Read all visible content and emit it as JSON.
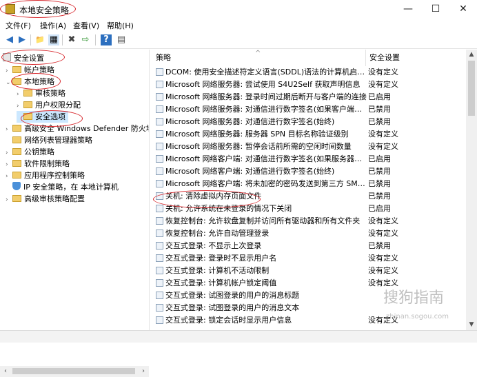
{
  "window": {
    "title": "本地安全策略",
    "minimize": "—",
    "maximize": "☐",
    "close": "✕"
  },
  "menu": [
    "文件(F)",
    "操作(A)",
    "查看(V)",
    "帮助(H)"
  ],
  "toolbar": {
    "back": "◀",
    "forward": "▶",
    "up": "📁",
    "show_hide": "▦",
    "delete": "✖",
    "export": "⇨",
    "help": "?",
    "properties": "▤"
  },
  "tree": {
    "root": "安全设置",
    "account": "帐户策略",
    "local": "本地策略",
    "audit": "审核策略",
    "rights": "用户权限分配",
    "security_options": "安全选项",
    "defender": "高级安全 Windows Defender 防火墙",
    "netlist": "网络列表管理器策略",
    "pubkey": "公钥策略",
    "swr": "软件限制策略",
    "applocker": "应用程序控制策略",
    "ipsec": "IP 安全策略，在 本地计算机",
    "advaudit": "高级审核策略配置"
  },
  "columns": {
    "policy": "策略",
    "setting": "安全设置"
  },
  "policies": [
    {
      "name": "DCOM: 使用安全描述符定义语言(SDDL)语法的计算机启动...",
      "value": "没有定义"
    },
    {
      "name": "Microsoft 网络服务器: 尝试使用 S4U2Self 获取声明信息",
      "value": "没有定义"
    },
    {
      "name": "Microsoft 网络服务器: 登录时间过期后断开与客户端的连接",
      "value": "已启用"
    },
    {
      "name": "Microsoft 网络服务器: 对通信进行数字签名(如果客户端允...",
      "value": "已禁用"
    },
    {
      "name": "Microsoft 网络服务器: 对通信进行数字签名(始终)",
      "value": "已禁用"
    },
    {
      "name": "Microsoft 网络服务器: 服务器 SPN 目标名称验证级别",
      "value": "没有定义"
    },
    {
      "name": "Microsoft 网络服务器: 暂停会话前所需的空闲时间数量",
      "value": "没有定义"
    },
    {
      "name": "Microsoft 网络客户端: 对通信进行数字签名(如果服务器允...",
      "value": "已启用"
    },
    {
      "name": "Microsoft 网络客户端: 对通信进行数字签名(始终)",
      "value": "已禁用"
    },
    {
      "name": "Microsoft 网络客户端: 将未加密的密码发送到第三方 SMB...",
      "value": "已禁用"
    },
    {
      "name": "关机: 清除虚拟内存页面文件",
      "value": "已禁用"
    },
    {
      "name": "关机: 允许系统在未登录的情况下关闭",
      "value": "已启用"
    },
    {
      "name": "恢复控制台: 允许软盘复制并访问所有驱动器和所有文件夹",
      "value": "没有定义"
    },
    {
      "name": "恢复控制台: 允许自动管理登录",
      "value": "没有定义"
    },
    {
      "name": "交互式登录: 不显示上次登录",
      "value": "已禁用"
    },
    {
      "name": "交互式登录: 登录时不显示用户名",
      "value": "没有定义"
    },
    {
      "name": "交互式登录: 计算机不活动限制",
      "value": "没有定义"
    },
    {
      "name": "交互式登录: 计算机帐户锁定阈值",
      "value": "没有定义"
    },
    {
      "name": "交互式登录: 试图登录的用户的消息标题",
      "value": ""
    },
    {
      "name": "交互式登录: 试图登录的用户的消息文本",
      "value": ""
    },
    {
      "name": "交互式登录: 锁定会话时显示用户信息",
      "value": "没有定义"
    }
  ],
  "watermark": {
    "brand": "搜狗指南",
    "url": "zhinan.sogou.com"
  }
}
